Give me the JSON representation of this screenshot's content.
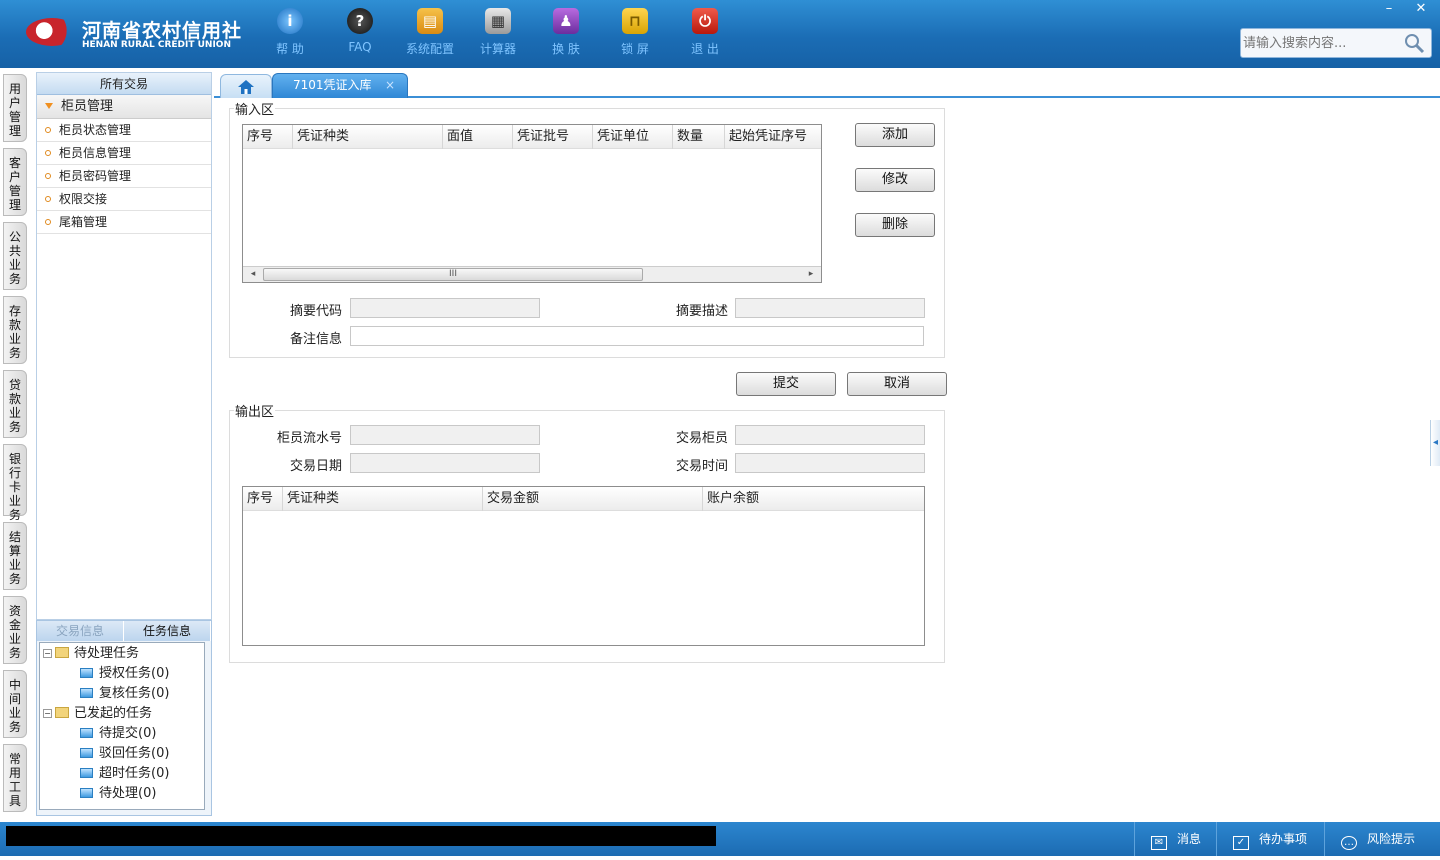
{
  "header": {
    "logo_cn": "河南省农村信用社",
    "logo_en": "HENAN RURAL CREDIT UNION",
    "tools": [
      {
        "label": "帮 助",
        "icon": "help-icon"
      },
      {
        "label": "FAQ",
        "icon": "faq-icon"
      },
      {
        "label": "系统配置",
        "icon": "toolbox-icon"
      },
      {
        "label": "计算器",
        "icon": "calculator-icon"
      },
      {
        "label": "换 肤",
        "icon": "shirt-icon"
      },
      {
        "label": "锁 屏",
        "icon": "lock-icon"
      },
      {
        "label": "退 出",
        "icon": "power-icon"
      }
    ],
    "window": {
      "minimize": "–",
      "close": "✕"
    },
    "search_placeholder": "请输入搜索内容..."
  },
  "vtabs": [
    "用户管理",
    "客户管理",
    "公共业务",
    "存款业务",
    "贷款业务",
    "银行卡业务",
    "结算业务",
    "资金业务",
    "中间业务",
    "常用工具"
  ],
  "sidebar": {
    "title": "所有交易",
    "group": "柜员管理",
    "items": [
      "柜员状态管理",
      "柜员信息管理",
      "柜员密码管理",
      "权限交接",
      "尾箱管理"
    ]
  },
  "task_panel": {
    "tabs": [
      "交易信息",
      "任务信息"
    ],
    "tree": [
      {
        "type": "folder",
        "label": "待处理任务",
        "pm": "−"
      },
      {
        "type": "leaf",
        "label": "授权任务(0)"
      },
      {
        "type": "leaf",
        "label": "复核任务(0)"
      },
      {
        "type": "folder",
        "label": "已发起的任务",
        "pm": "−"
      },
      {
        "type": "leaf",
        "label": "待提交(0)"
      },
      {
        "type": "leaf",
        "label": "驳回任务(0)"
      },
      {
        "type": "leaf",
        "label": "超时任务(0)"
      },
      {
        "type": "leaf",
        "label": "待处理(0)"
      }
    ]
  },
  "tabs": {
    "active": "7101凭证入库",
    "close": "×"
  },
  "input_area": {
    "title": "输入区",
    "columns": [
      "序号",
      "凭证种类",
      "面值",
      "凭证批号",
      "凭证单位",
      "数量",
      "起始凭证序号"
    ],
    "scroll": {
      "left": "◂",
      "right": "▸",
      "thumb": "III"
    },
    "buttons": {
      "add": "添加",
      "edit": "修改",
      "delete": "删除"
    },
    "fields": {
      "summary_code": "摘要代码",
      "summary_desc": "摘要描述",
      "remark": "备注信息"
    }
  },
  "actions": {
    "submit": "提交",
    "cancel": "取消"
  },
  "output_area": {
    "title": "输出区",
    "fields": {
      "teller_serial": "柜员流水号",
      "trade_teller": "交易柜员",
      "trade_date": "交易日期",
      "trade_time": "交易时间"
    },
    "columns": [
      "序号",
      "凭证种类",
      "交易金额",
      "账户余额"
    ]
  },
  "statusbar": {
    "message": "消息",
    "todo": "待办事项",
    "risk": "风险提示"
  }
}
